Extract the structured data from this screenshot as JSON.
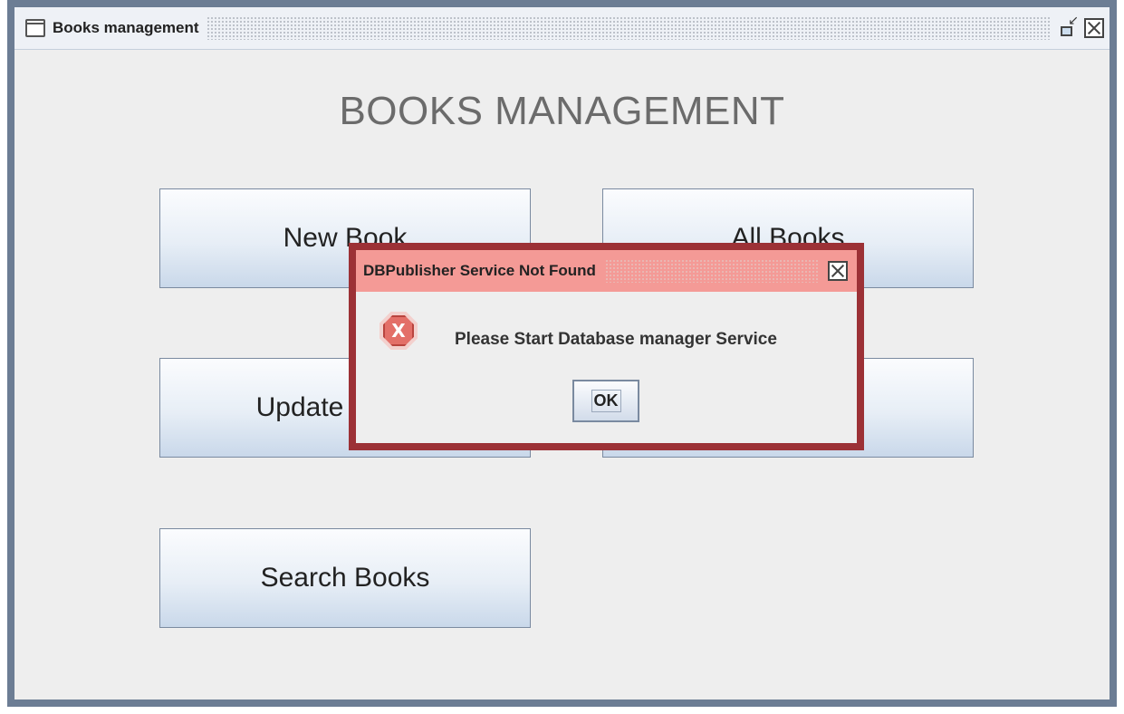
{
  "window": {
    "title": "Books management",
    "heading": "BOOKS MANAGEMENT"
  },
  "buttons": {
    "new_book": "New Book",
    "all_books": "All Books",
    "update": "Update",
    "delete": "",
    "search_books": "Search Books"
  },
  "dialog": {
    "title": "DBPublisher Service Not Found",
    "message": "Please Start Database manager Service",
    "ok_label": "OK",
    "icon_glyph": "X"
  },
  "colors": {
    "window_border": "#6c7d94",
    "dialog_border": "#9c3136",
    "dialog_title_bg": "#f49a96"
  },
  "icons": {
    "window": "window-icon",
    "restore": "restore-icon",
    "close": "close-icon",
    "error": "error-icon"
  }
}
